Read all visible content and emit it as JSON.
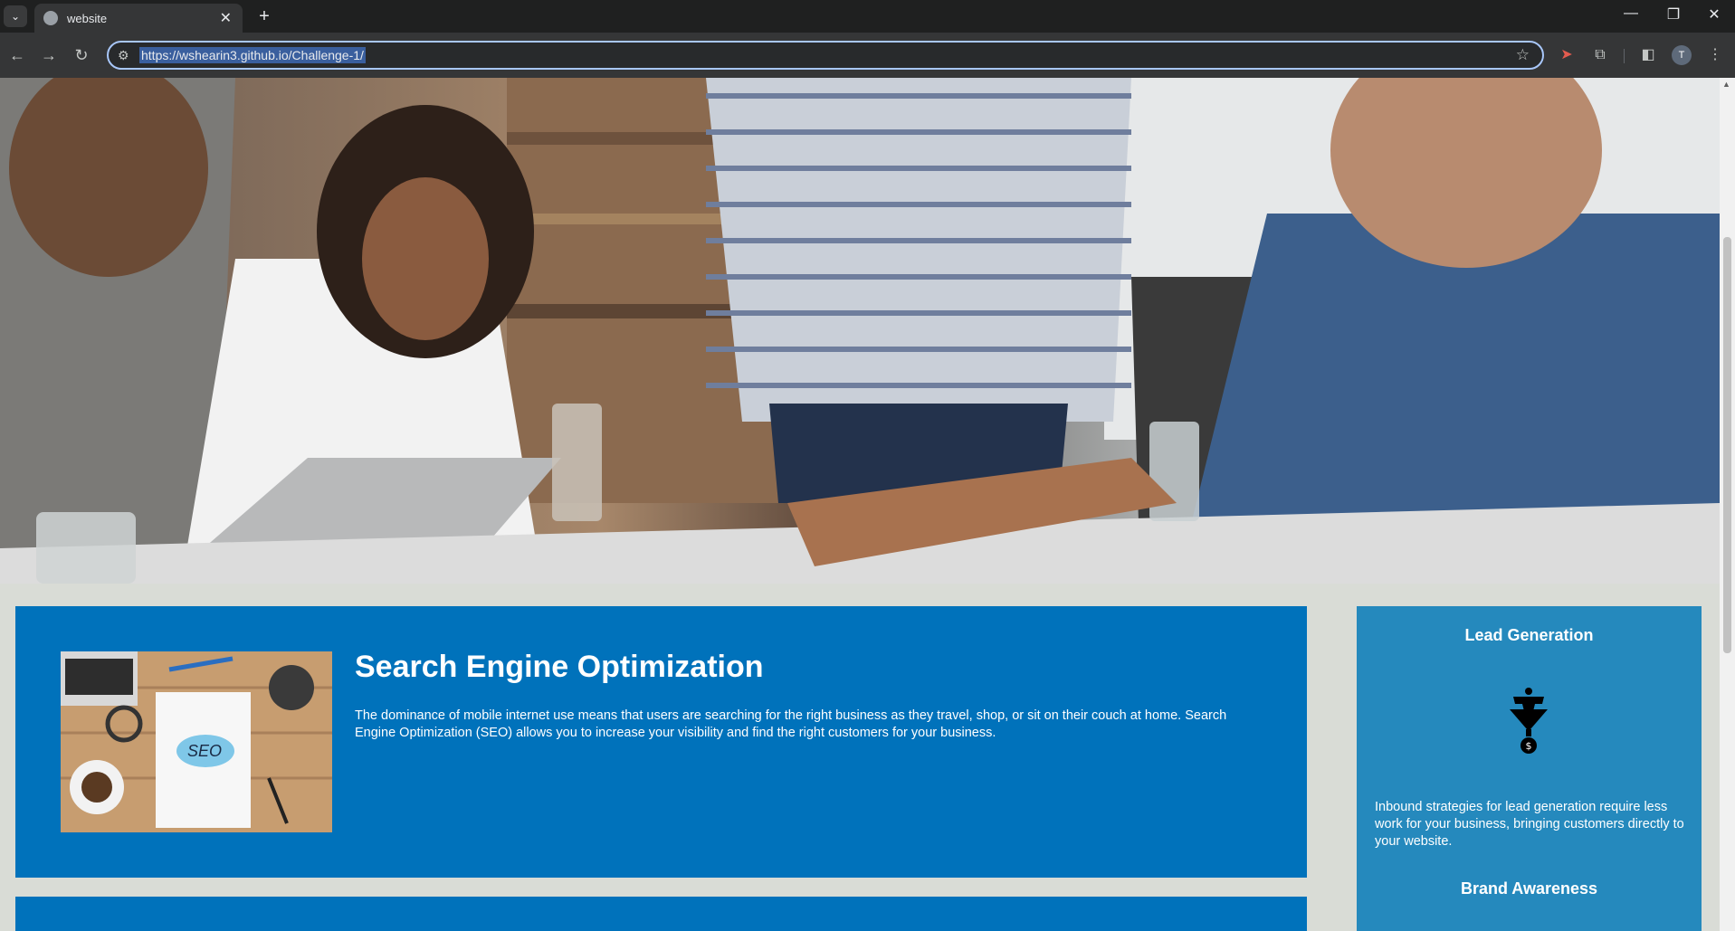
{
  "browser": {
    "tab_title": "website",
    "new_tab_label": "+",
    "url": "https://wshearin3.github.io/Challenge-1/",
    "avatar_initial": "T"
  },
  "seo": {
    "title": "Search Engine Optimization",
    "text": "The dominance of mobile internet use means that users are searching for the right business as they travel, shop, or sit on their couch at home. Search Engine Optimization (SEO) allows you to increase your visibility and find the right customers for your business.",
    "image_label": "SEO"
  },
  "aside": {
    "lead_title": "Lead Generation",
    "lead_text": "Inbound strategies for lead generation require less work for your business, bringing customers directly to your website.",
    "brand_title": "Brand Awareness"
  },
  "colors": {
    "card_blue": "#0072bb",
    "aside_blue": "#2589bd",
    "page_bg": "#d9dcd6"
  }
}
